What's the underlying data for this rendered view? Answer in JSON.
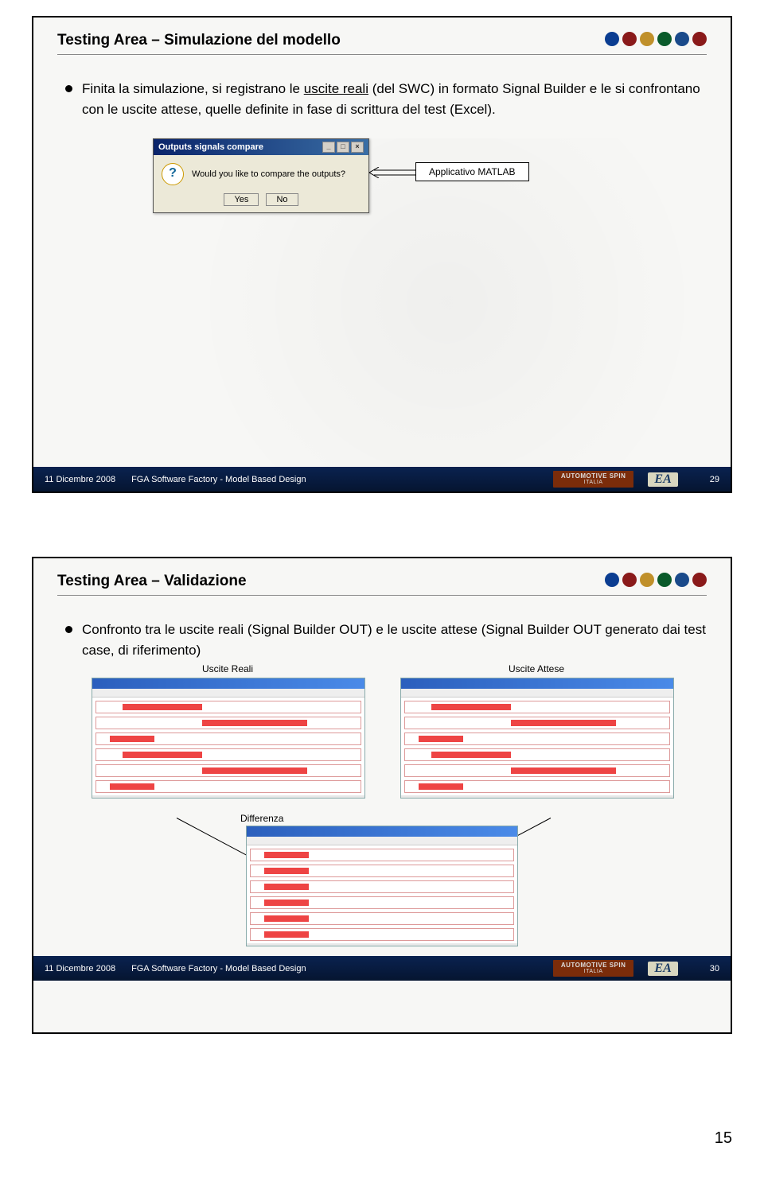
{
  "slide1": {
    "title": "Testing Area – Simulazione del modello",
    "bullet_html": "Finita la simulazione, si registrano le <u>uscite reali</u> (del SWC) in formato Signal Builder e le si confrontano con le uscite attese, quelle definite in fase di scrittura del test (Excel).",
    "dialog": {
      "title": "Outputs signals compare",
      "message": "Would you like to compare the outputs?",
      "yes": "Yes",
      "no": "No"
    },
    "label_box": "Applicativo MATLAB",
    "footer": {
      "date": "11 Dicembre 2008",
      "mid": "FGA Software Factory - Model Based Design",
      "orange_top": "AUTOMOTIVE SPIN",
      "orange_bottom": "ITALIA",
      "ea": "EA",
      "page": "29"
    }
  },
  "slide2": {
    "title": "Testing Area – Validazione",
    "bullet_html": "Confronto tra le uscite reali (Signal Builder OUT) e le uscite attese (Signal Builder OUT generato dai test case, di riferimento)",
    "label_reali": "Uscite Reali",
    "label_attese": "Uscite Attese",
    "label_diff": "Differenza",
    "footer": {
      "date": "11 Dicembre 2008",
      "mid": "FGA Software Factory - Model Based Design",
      "orange_top": "AUTOMOTIVE SPIN",
      "orange_bottom": "ITALIA",
      "ea": "EA",
      "page": "30"
    }
  },
  "doc_page": "15",
  "brand_colors": [
    "#0b3d91",
    "#8a1a1a",
    "#c0902a",
    "#0a5a2a",
    "#1a4a8a",
    "#8a1a1a"
  ]
}
